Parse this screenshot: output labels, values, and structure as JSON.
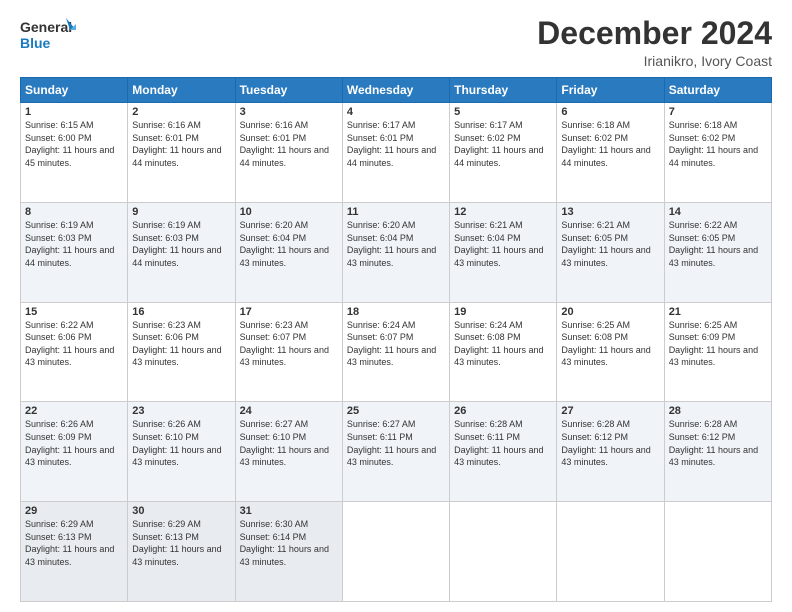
{
  "header": {
    "logo_line1": "General",
    "logo_line2": "Blue",
    "title": "December 2024",
    "subtitle": "Irianikro, Ivory Coast"
  },
  "days_of_week": [
    "Sunday",
    "Monday",
    "Tuesday",
    "Wednesday",
    "Thursday",
    "Friday",
    "Saturday"
  ],
  "weeks": [
    [
      {
        "day": "1",
        "sunrise": "6:15 AM",
        "sunset": "6:00 PM",
        "daylight": "11 hours and 45 minutes."
      },
      {
        "day": "2",
        "sunrise": "6:16 AM",
        "sunset": "6:01 PM",
        "daylight": "11 hours and 44 minutes."
      },
      {
        "day": "3",
        "sunrise": "6:16 AM",
        "sunset": "6:01 PM",
        "daylight": "11 hours and 44 minutes."
      },
      {
        "day": "4",
        "sunrise": "6:17 AM",
        "sunset": "6:01 PM",
        "daylight": "11 hours and 44 minutes."
      },
      {
        "day": "5",
        "sunrise": "6:17 AM",
        "sunset": "6:02 PM",
        "daylight": "11 hours and 44 minutes."
      },
      {
        "day": "6",
        "sunrise": "6:18 AM",
        "sunset": "6:02 PM",
        "daylight": "11 hours and 44 minutes."
      },
      {
        "day": "7",
        "sunrise": "6:18 AM",
        "sunset": "6:02 PM",
        "daylight": "11 hours and 44 minutes."
      }
    ],
    [
      {
        "day": "8",
        "sunrise": "6:19 AM",
        "sunset": "6:03 PM",
        "daylight": "11 hours and 44 minutes."
      },
      {
        "day": "9",
        "sunrise": "6:19 AM",
        "sunset": "6:03 PM",
        "daylight": "11 hours and 44 minutes."
      },
      {
        "day": "10",
        "sunrise": "6:20 AM",
        "sunset": "6:04 PM",
        "daylight": "11 hours and 43 minutes."
      },
      {
        "day": "11",
        "sunrise": "6:20 AM",
        "sunset": "6:04 PM",
        "daylight": "11 hours and 43 minutes."
      },
      {
        "day": "12",
        "sunrise": "6:21 AM",
        "sunset": "6:04 PM",
        "daylight": "11 hours and 43 minutes."
      },
      {
        "day": "13",
        "sunrise": "6:21 AM",
        "sunset": "6:05 PM",
        "daylight": "11 hours and 43 minutes."
      },
      {
        "day": "14",
        "sunrise": "6:22 AM",
        "sunset": "6:05 PM",
        "daylight": "11 hours and 43 minutes."
      }
    ],
    [
      {
        "day": "15",
        "sunrise": "6:22 AM",
        "sunset": "6:06 PM",
        "daylight": "11 hours and 43 minutes."
      },
      {
        "day": "16",
        "sunrise": "6:23 AM",
        "sunset": "6:06 PM",
        "daylight": "11 hours and 43 minutes."
      },
      {
        "day": "17",
        "sunrise": "6:23 AM",
        "sunset": "6:07 PM",
        "daylight": "11 hours and 43 minutes."
      },
      {
        "day": "18",
        "sunrise": "6:24 AM",
        "sunset": "6:07 PM",
        "daylight": "11 hours and 43 minutes."
      },
      {
        "day": "19",
        "sunrise": "6:24 AM",
        "sunset": "6:08 PM",
        "daylight": "11 hours and 43 minutes."
      },
      {
        "day": "20",
        "sunrise": "6:25 AM",
        "sunset": "6:08 PM",
        "daylight": "11 hours and 43 minutes."
      },
      {
        "day": "21",
        "sunrise": "6:25 AM",
        "sunset": "6:09 PM",
        "daylight": "11 hours and 43 minutes."
      }
    ],
    [
      {
        "day": "22",
        "sunrise": "6:26 AM",
        "sunset": "6:09 PM",
        "daylight": "11 hours and 43 minutes."
      },
      {
        "day": "23",
        "sunrise": "6:26 AM",
        "sunset": "6:10 PM",
        "daylight": "11 hours and 43 minutes."
      },
      {
        "day": "24",
        "sunrise": "6:27 AM",
        "sunset": "6:10 PM",
        "daylight": "11 hours and 43 minutes."
      },
      {
        "day": "25",
        "sunrise": "6:27 AM",
        "sunset": "6:11 PM",
        "daylight": "11 hours and 43 minutes."
      },
      {
        "day": "26",
        "sunrise": "6:28 AM",
        "sunset": "6:11 PM",
        "daylight": "11 hours and 43 minutes."
      },
      {
        "day": "27",
        "sunrise": "6:28 AM",
        "sunset": "6:12 PM",
        "daylight": "11 hours and 43 minutes."
      },
      {
        "day": "28",
        "sunrise": "6:28 AM",
        "sunset": "6:12 PM",
        "daylight": "11 hours and 43 minutes."
      }
    ],
    [
      {
        "day": "29",
        "sunrise": "6:29 AM",
        "sunset": "6:13 PM",
        "daylight": "11 hours and 43 minutes."
      },
      {
        "day": "30",
        "sunrise": "6:29 AM",
        "sunset": "6:13 PM",
        "daylight": "11 hours and 43 minutes."
      },
      {
        "day": "31",
        "sunrise": "6:30 AM",
        "sunset": "6:14 PM",
        "daylight": "11 hours and 43 minutes."
      },
      null,
      null,
      null,
      null
    ]
  ],
  "labels": {
    "sunrise_prefix": "Sunrise: ",
    "sunset_prefix": "Sunset: ",
    "daylight_prefix": "Daylight: "
  }
}
